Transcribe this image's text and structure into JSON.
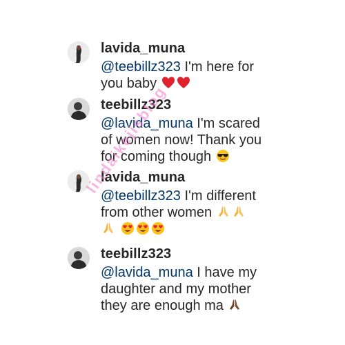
{
  "comments": [
    {
      "username": "lavida_muna",
      "mention": "@teebillz323",
      "text_parts": [
        " I'm here for",
        "you baby"
      ],
      "emoji": [
        "red-heart",
        "red-heart"
      ]
    },
    {
      "username": "teebillz323",
      "mention": "@lavida_muna",
      "text_parts": [
        " I'm scared",
        "of women now! Thank you",
        "for coming though"
      ],
      "emoji": [
        "sunglasses-face"
      ]
    },
    {
      "username": "lavida_muna",
      "mention": "@teebillz323",
      "text_parts": [
        " I'm different",
        "from other women"
      ],
      "emoji": [
        "folded-hands",
        "folded-hands",
        "folded-hands",
        "heart-eyes-face",
        "heart-eyes-face",
        "heart-eyes-face"
      ]
    },
    {
      "username": "teebillz323",
      "mention": "@lavida_muna",
      "text_parts": [
        " I have my",
        "daughter and my mother",
        "they are enough ma"
      ],
      "emoji": [
        "folded-hands-dark"
      ]
    }
  ],
  "watermark": "lindaikejisblog",
  "colors": {
    "text": "#262626",
    "mention": "#003569",
    "watermark": "#f078c8"
  }
}
